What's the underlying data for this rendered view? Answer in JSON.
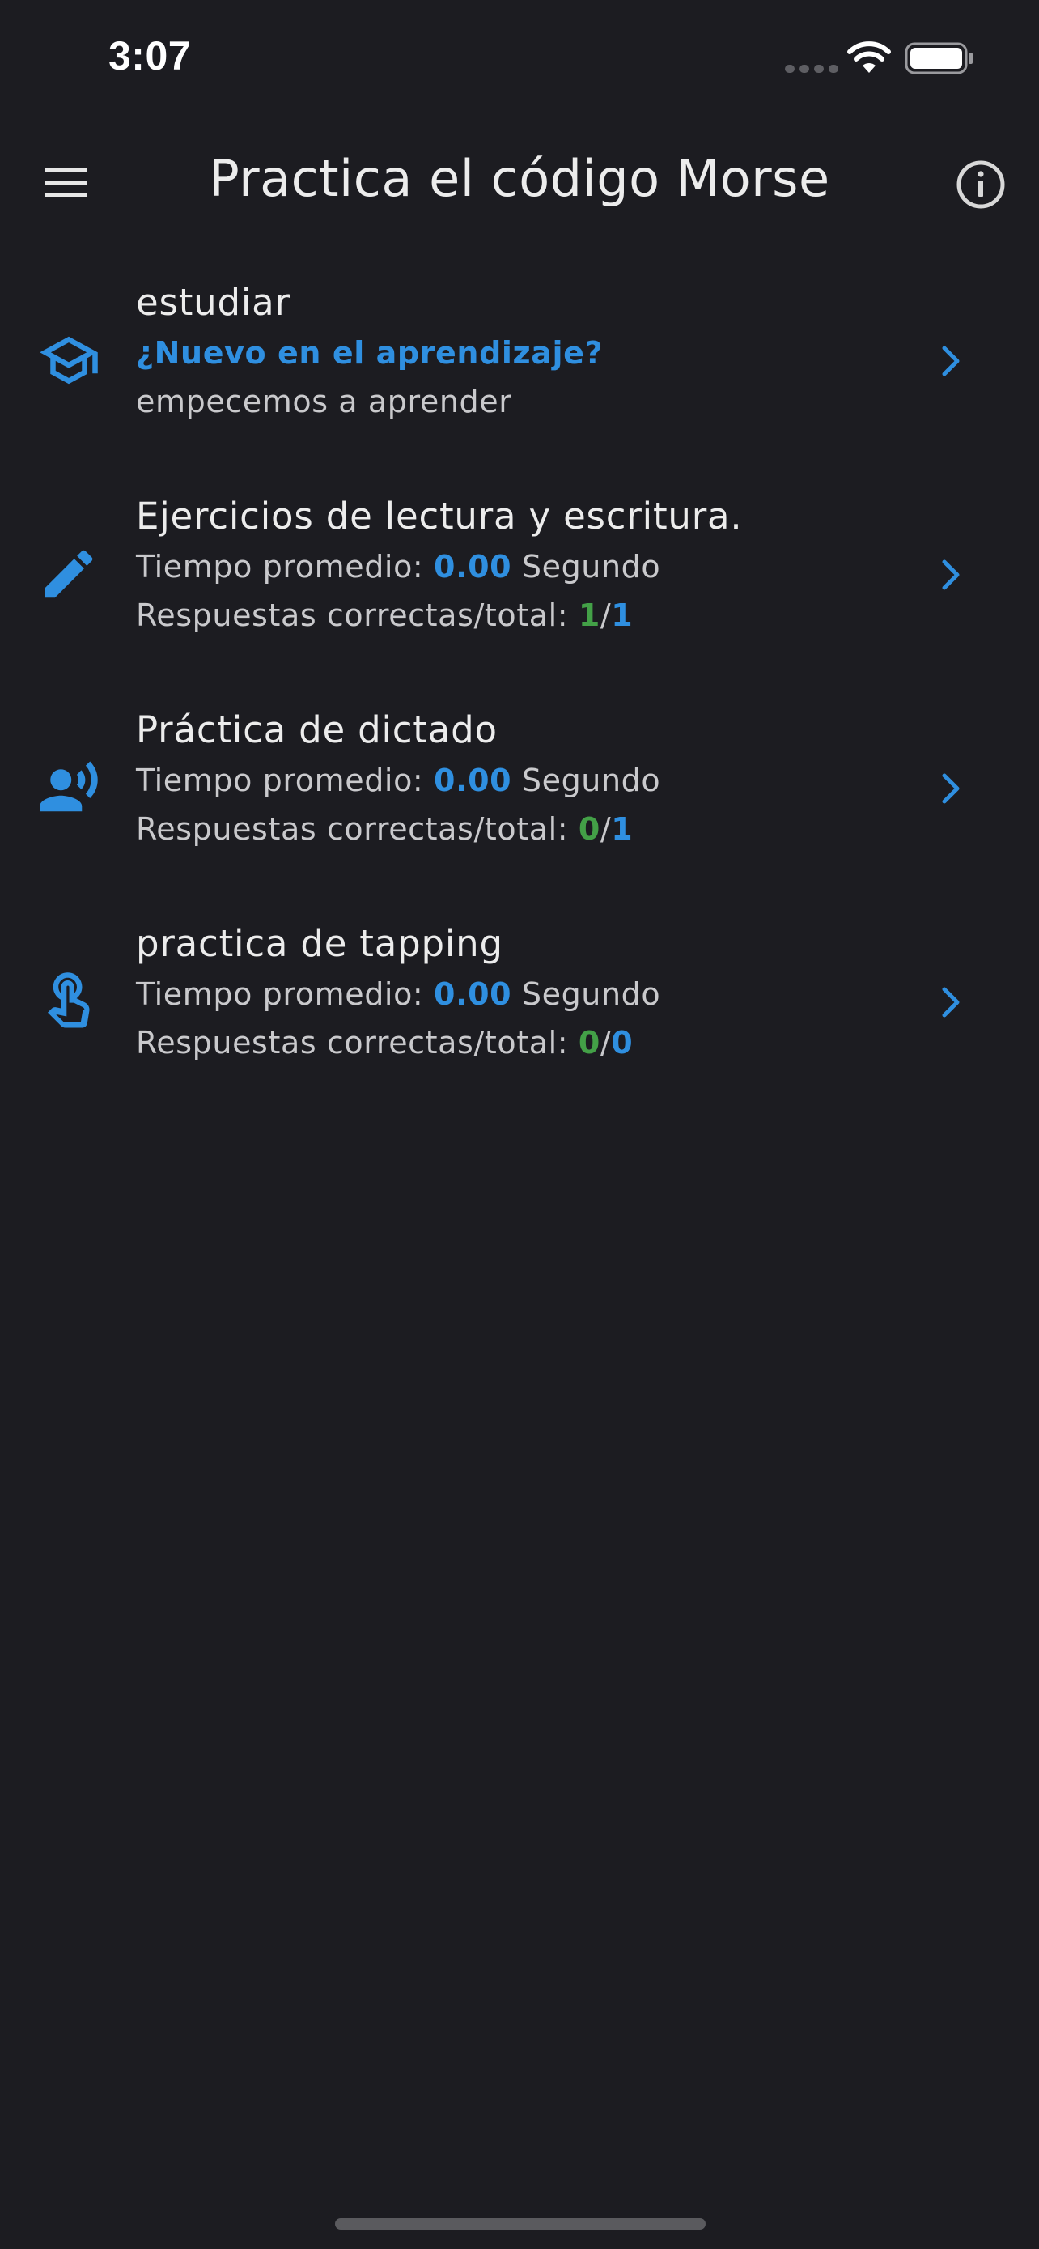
{
  "status_bar": {
    "time": "3:07"
  },
  "header": {
    "title": "Practica el código Morse",
    "menu_icon": "hamburger-menu-icon",
    "info_icon": "info-circle-icon"
  },
  "colors": {
    "background": "#1c1c21",
    "accent_blue": "#2f8fe0",
    "accent_green": "#43a047",
    "text_primary": "#ececec",
    "text_secondary": "#c9c9cc"
  },
  "items": [
    {
      "icon": "graduation-cap-icon",
      "title": "estudiar",
      "subtitle": "¿Nuevo en el aprendizaje?",
      "description": "empecemos a aprender"
    },
    {
      "icon": "pencil-icon",
      "title": "Ejercicios de lectura y escritura.",
      "time_label": "Tiempo promedio:",
      "time_value": "0.00",
      "time_unit": "Segundo",
      "answers_label": "Respuestas correctas/total:",
      "correct": "1",
      "separator": "/",
      "total": "1"
    },
    {
      "icon": "person-speaking-icon",
      "title": "Práctica de dictado",
      "time_label": "Tiempo promedio:",
      "time_value": "0.00",
      "time_unit": "Segundo",
      "answers_label": "Respuestas correctas/total:",
      "correct": "0",
      "separator": "/",
      "total": "1"
    },
    {
      "icon": "finger-tap-icon",
      "title": "practica de tapping",
      "time_label": "Tiempo promedio:",
      "time_value": "0.00",
      "time_unit": "Segundo",
      "answers_label": "Respuestas correctas/total:",
      "correct": "0",
      "separator": "/",
      "total": "0"
    }
  ]
}
